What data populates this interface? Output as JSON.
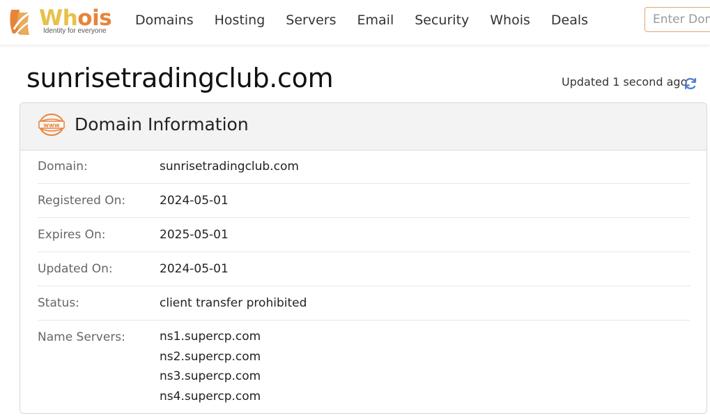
{
  "brand": {
    "name_part1": "Wh",
    "name_part2": "is",
    "tagline": "Identity for everyone",
    "colors": {
      "yellow": "#e7c14a",
      "orange": "#e8833a"
    }
  },
  "nav": {
    "items": [
      {
        "label": "Domains"
      },
      {
        "label": "Hosting"
      },
      {
        "label": "Servers"
      },
      {
        "label": "Email"
      },
      {
        "label": "Security"
      },
      {
        "label": "Whois"
      },
      {
        "label": "Deals"
      }
    ]
  },
  "search": {
    "placeholder": "Enter Domain or IP"
  },
  "page": {
    "domain_title": "sunrisetradingclub.com",
    "updated_text": "Updated 1 second ago",
    "refresh_icon": "refresh-icon"
  },
  "card": {
    "title": "Domain Information",
    "icon": "www-globe-icon",
    "rows": [
      {
        "label": "Domain:",
        "value": "sunrisetradingclub.com"
      },
      {
        "label": "Registered On:",
        "value": "2024-05-01"
      },
      {
        "label": "Expires On:",
        "value": "2025-05-01"
      },
      {
        "label": "Updated On:",
        "value": "2024-05-01"
      },
      {
        "label": "Status:",
        "value": "client transfer prohibited"
      }
    ],
    "name_servers": {
      "label": "Name Servers:",
      "values": [
        "ns1.supercp.com",
        "ns2.supercp.com",
        "ns3.supercp.com",
        "ns4.supercp.com"
      ]
    }
  }
}
